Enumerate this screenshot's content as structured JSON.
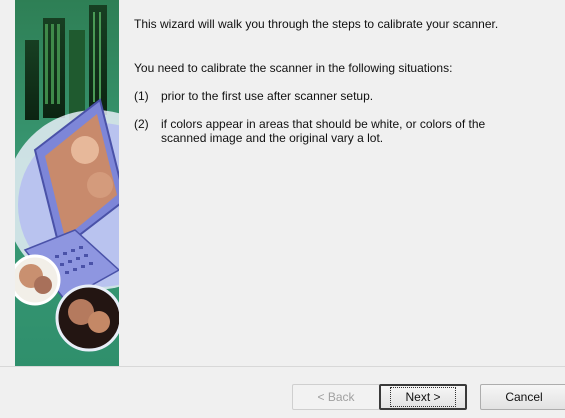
{
  "intro": "This wizard will walk you through the steps to calibrate your scanner.",
  "situations_heading": "You need to calibrate the scanner in the following situations:",
  "items": [
    {
      "num": "(1)",
      "text": "prior to the first use after scanner setup."
    },
    {
      "num": "(2)",
      "text": "if colors appear in areas that should be white, or colors of the scanned image and the original vary a lot."
    }
  ],
  "buttons": {
    "back": "< Back",
    "next": "Next >",
    "cancel": "Cancel"
  },
  "colors": {
    "art_background": "#2f8a68",
    "laptop": "#7d86d8"
  }
}
